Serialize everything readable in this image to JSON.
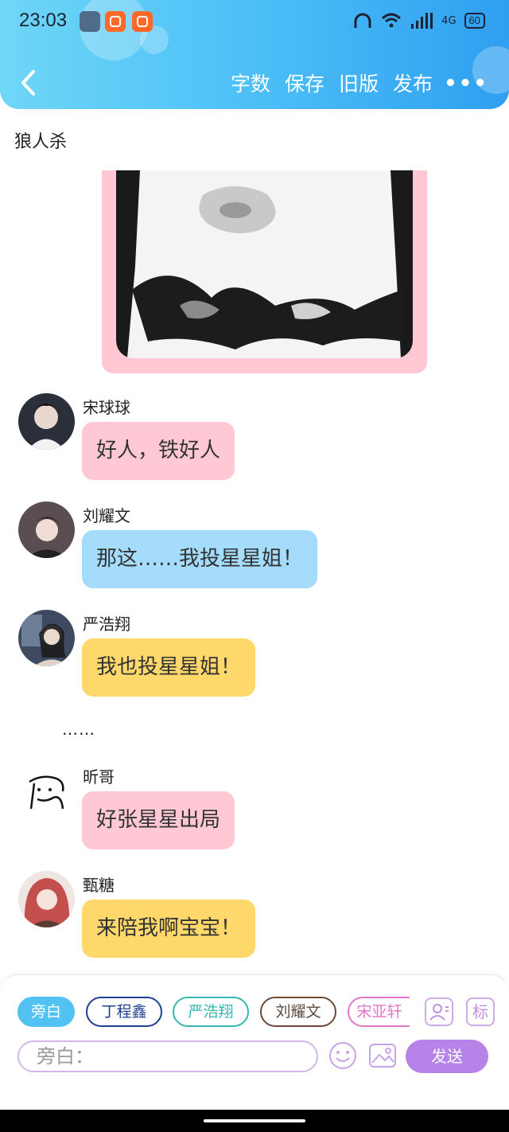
{
  "status_bar": {
    "time": "23:03",
    "network": "4G",
    "battery": "60"
  },
  "nav": {
    "actions": [
      "字数",
      "保存",
      "旧版",
      "发布"
    ],
    "more": "•••"
  },
  "title": "狼人杀",
  "messages": [
    {
      "name": "宋球球",
      "text": "好人，铁好人",
      "color": "#ffc8d4"
    },
    {
      "name": "刘耀文",
      "text": "那这……我投星星姐！",
      "color": "#a6dcfb"
    },
    {
      "name": "严浩翔",
      "text": "我也投星星姐！",
      "color": "#ffd86b"
    },
    {
      "name": "昕哥",
      "text": "好张星星出局",
      "color": "#ffc8d4"
    },
    {
      "name": "甄糖",
      "text": "来陪我啊宝宝！",
      "color": "#ffd86b"
    }
  ],
  "ellipsis": "……",
  "composer": {
    "roles": [
      {
        "label": "旁白",
        "color": "#52c2f3",
        "active": true
      },
      {
        "label": "丁程鑫",
        "color": "#1f3f8f"
      },
      {
        "label": "严浩翔",
        "color": "#35b8b0"
      },
      {
        "label": "刘耀文",
        "color": "#6b4a3a"
      },
      {
        "label": "宋亚轩",
        "color": "#e277c8"
      }
    ],
    "placeholder": "旁白：",
    "send_label": "发送",
    "mark_label": "标"
  }
}
